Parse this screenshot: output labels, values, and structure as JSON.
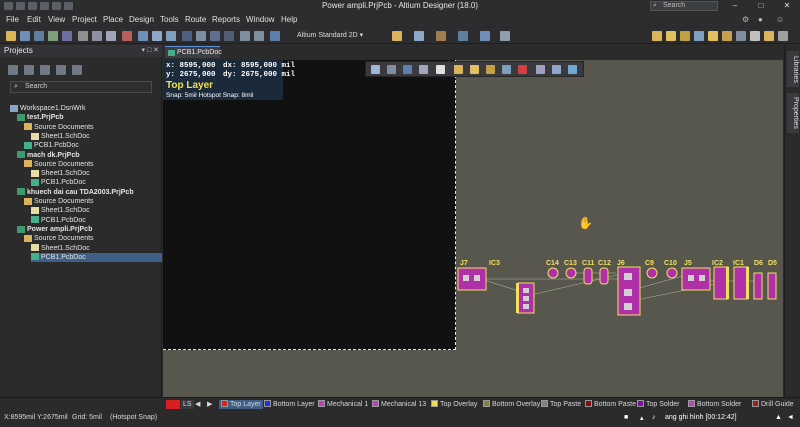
{
  "window": {
    "title": "Power ampli.PrjPcb - Altium Designer (18.0)",
    "search_placeholder": "Search"
  },
  "menu": [
    "File",
    "Edit",
    "View",
    "Project",
    "Place",
    "Design",
    "Tools",
    "Route",
    "Reports",
    "Window",
    "Help"
  ],
  "toolbar": {
    "view_mode": "Altium Standard 2D"
  },
  "projects_panel": {
    "title": "Projects",
    "search_placeholder": "Search",
    "tree": [
      {
        "label": "Workspace1.DsnWrk",
        "icon": "workspace-icon",
        "level": 0,
        "bold": false
      },
      {
        "label": "test.PrjPcb",
        "icon": "project-icon",
        "level": 1,
        "bold": true
      },
      {
        "label": "Source Documents",
        "icon": "folder-icon",
        "level": 2,
        "bold": false
      },
      {
        "label": "Sheet1.SchDoc",
        "icon": "schematic-icon",
        "level": 3,
        "bold": false
      },
      {
        "label": "PCB1.PcbDoc",
        "icon": "pcb-icon",
        "level": 2,
        "bold": false
      },
      {
        "label": "mach dk.PrjPcb",
        "icon": "project-icon",
        "level": 1,
        "bold": true
      },
      {
        "label": "Source Documents",
        "icon": "folder-icon",
        "level": 2,
        "bold": false
      },
      {
        "label": "Sheet1.SchDoc",
        "icon": "schematic-icon",
        "level": 3,
        "bold": false
      },
      {
        "label": "PCB1.PcbDoc",
        "icon": "pcb-icon",
        "level": 3,
        "bold": false
      },
      {
        "label": "khuech dai cau TDA2003.PrjPcb",
        "icon": "project-icon",
        "level": 1,
        "bold": true
      },
      {
        "label": "Source Documents",
        "icon": "folder-icon",
        "level": 2,
        "bold": false
      },
      {
        "label": "Sheet1.SchDoc",
        "icon": "schematic-icon",
        "level": 3,
        "bold": false
      },
      {
        "label": "PCB1.PcbDoc",
        "icon": "pcb-icon",
        "level": 3,
        "bold": false
      },
      {
        "label": "Power ampli.PrjPcb",
        "icon": "project-icon",
        "level": 1,
        "bold": true,
        "selected": true
      },
      {
        "label": "Source Documents",
        "icon": "folder-icon",
        "level": 2,
        "bold": false
      },
      {
        "label": "Sheet1.SchDoc",
        "icon": "schematic-icon",
        "level": 3,
        "bold": false
      },
      {
        "label": "PCB1.PcbDoc",
        "icon": "pcb-icon",
        "level": 3,
        "bold": false,
        "selected": true
      }
    ]
  },
  "document_tab": "PCB1.PcbDoc",
  "hud": {
    "x": "x:  8595,000",
    "dx": "dx:  8595,000 mil",
    "y": "y:  2675,000",
    "dy": "dy:  2675,000 mil",
    "layer": "Top Layer",
    "snap": "Snap: 5mil Hotspot Snap: 8mil"
  },
  "right_tabs": [
    "Libraries",
    "Properties"
  ],
  "components": [
    "J7",
    "IC3",
    "C14",
    "C13",
    "C11",
    "C12",
    "J6",
    "C9",
    "C10",
    "J5",
    "IC2",
    "IC1",
    "D6",
    "D5"
  ],
  "layer_tabs": [
    {
      "label": "LS",
      "color": "#d82020"
    },
    {
      "label": "Top Layer",
      "color": "#e02020",
      "active": true
    },
    {
      "label": "Bottom Layer",
      "color": "#2030e0"
    },
    {
      "label": "Mechanical 1",
      "color": "#c040c0"
    },
    {
      "label": "Mechanical 13",
      "color": "#c040c0"
    },
    {
      "label": "Top Overlay",
      "color": "#f0e040"
    },
    {
      "label": "Bottom Overlay",
      "color": "#808040"
    },
    {
      "label": "Top Paste",
      "color": "#808080"
    },
    {
      "label": "Bottom Paste",
      "color": "#801010"
    },
    {
      "label": "Top Solder",
      "color": "#8010a0"
    },
    {
      "label": "Bottom Solder",
      "color": "#c040c0"
    },
    {
      "label": "Drill Guide",
      "color": "#a02020"
    }
  ],
  "status": {
    "coords": "X:8595mil Y:2675mil",
    "grid": "Grid: 5mil",
    "snap": "(Hotspot Snap)",
    "recording": "ang ghi hình [00:12:42]"
  }
}
